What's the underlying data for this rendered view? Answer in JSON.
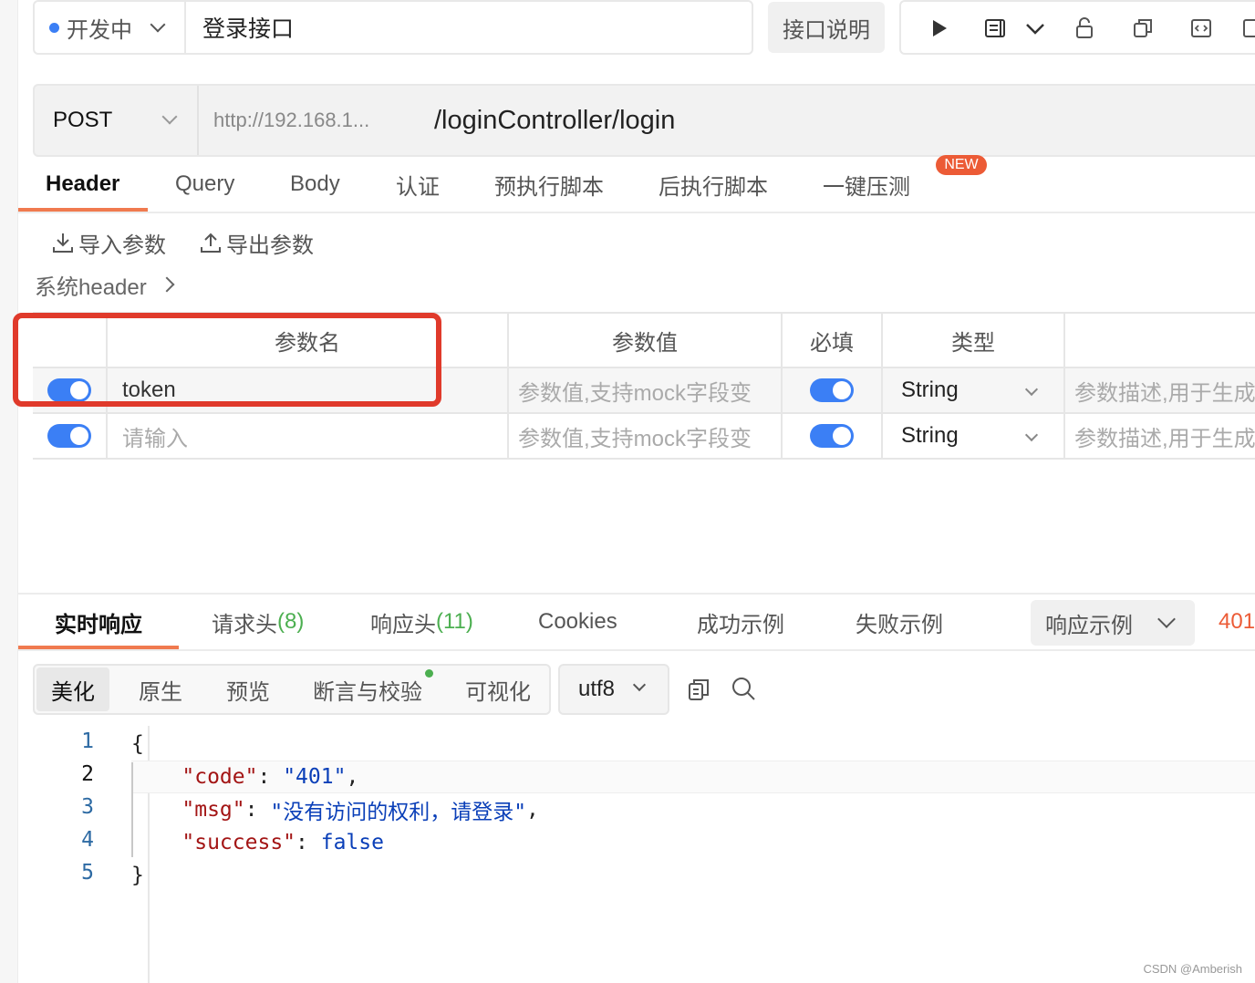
{
  "top": {
    "status": "开发中",
    "api_name": "登录接口",
    "desc_button": "接口说明"
  },
  "request": {
    "method": "POST",
    "env_url": "http://192.168.1...",
    "path": "/loginController/login"
  },
  "request_tabs": [
    "Header",
    "Query",
    "Body",
    "认证",
    "预执行脚本",
    "后执行脚本",
    "一键压测"
  ],
  "new_badge": "NEW",
  "actions": {
    "import": "导入参数",
    "export": "导出参数",
    "system_header": "系统header"
  },
  "table": {
    "headers": [
      "参数名",
      "参数值",
      "必填",
      "类型"
    ],
    "rows": [
      {
        "name": "token",
        "value_placeholder": "参数值,支持mock字段变",
        "type": "String",
        "desc_placeholder": "参数描述,用于生成"
      },
      {
        "name_placeholder": "请输入",
        "value_placeholder": "参数值,支持mock字段变",
        "type": "String",
        "desc_placeholder": "参数描述,用于生成"
      }
    ]
  },
  "response_tabs": {
    "realtime": "实时响应",
    "req_headers": "请求头",
    "req_headers_count": "(8)",
    "resp_headers": "响应头",
    "resp_headers_count": "(11)",
    "cookies": "Cookies",
    "success_example": "成功示例",
    "fail_example": "失败示例",
    "resp_example": "响应示例",
    "status_code": "401"
  },
  "view_modes": [
    "美化",
    "原生",
    "预览",
    "断言与校验",
    "可视化"
  ],
  "encoding": "utf8",
  "code": {
    "line_numbers": [
      "1",
      "2",
      "3",
      "4",
      "5"
    ],
    "open": "{",
    "code_key": "\"code\"",
    "code_val": "\"401\"",
    "msg_key": "\"msg\"",
    "msg_val": "\"没有访问的权利，请登录\"",
    "success_key": "\"success\"",
    "success_val": "false",
    "close": "}"
  },
  "watermark": "CSDN @Amberish",
  "colors": {
    "accent": "#f07a4f",
    "primary": "#3b7ff5",
    "highlight_box": "#e03a2b"
  }
}
